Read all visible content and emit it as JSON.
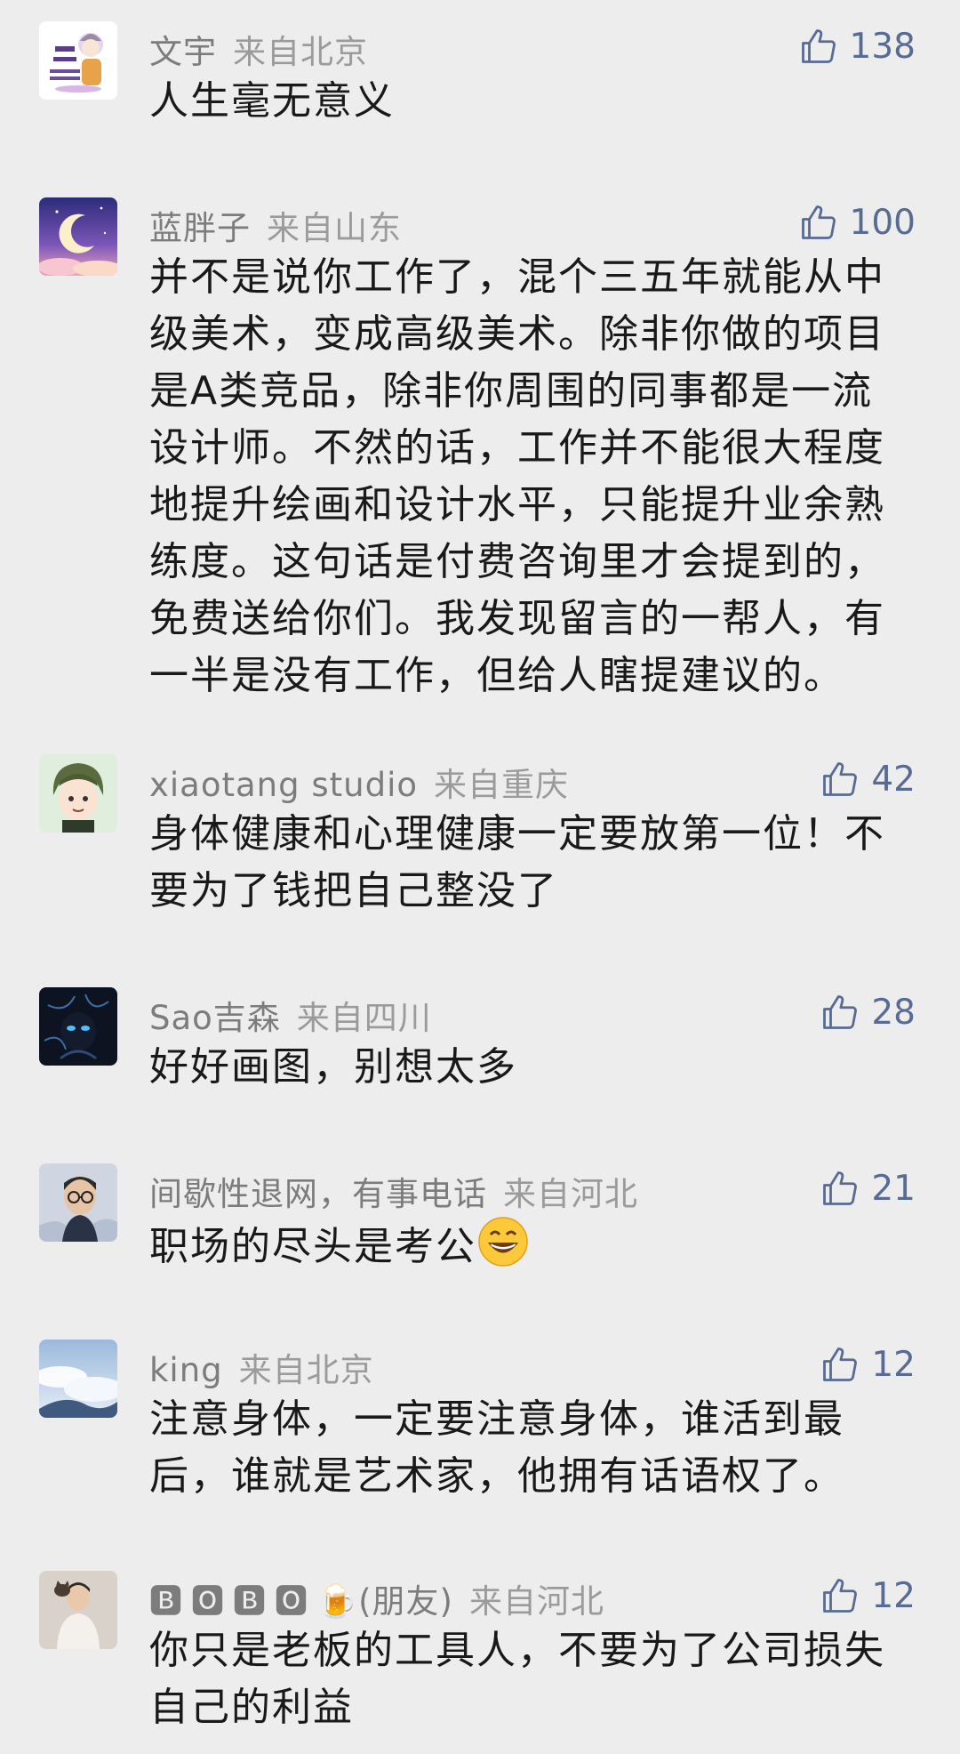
{
  "comments": [
    {
      "name": "文宇",
      "location": "来自北京",
      "likes": "138",
      "text": "人生毫无意义",
      "avatar": "cartoon-monk-avatar"
    },
    {
      "name": "蓝胖子",
      "location": "来自山东",
      "likes": "100",
      "text": "并不是说你工作了，混个三五年就能从中级美术，变成高级美术。除非你做的项目是A类竞品，除非你周围的同事都是一流设计师。不然的话，工作并不能很大程度地提升绘画和设计水平，只能提升业余熟练度。这句话是付费咨询里才会提到的，免费送给你们。我发现留言的一帮人，有一半是没有工作，但给人瞎提建议的。",
      "avatar": "moon-night-sky-avatar"
    },
    {
      "name": "xiaotang studio",
      "location": "来自重庆",
      "likes": "42",
      "text": "身体健康和心理健康一定要放第一位！不要为了钱把自己整没了",
      "avatar": "anime-boy-avatar"
    },
    {
      "name": "Sao吉森",
      "location": "来自四川",
      "likes": "28",
      "text": "好好画图，别想太多",
      "avatar": "dark-creature-avatar"
    },
    {
      "name": "间歇性退网，有事电话",
      "location": "来自河北",
      "likes": "21",
      "text": "职场的尽头是考公",
      "emoji": "grinning-emoji",
      "avatar": "man-with-glasses-avatar"
    },
    {
      "name": "king",
      "location": "来自北京",
      "likes": "12",
      "text": "注意身体，一定要注意身体，谁活到最后，谁就是艺术家，他拥有话语权了。",
      "avatar": "sky-clouds-avatar"
    },
    {
      "name": "🅱🅾🅱🅾",
      "name_suffix": "(朋友)",
      "location": "来自河北",
      "likes": "12",
      "text": "你只是老板的工具人，不要为了公司损失自己的利益",
      "name_emoji": "beer-mug-emoji",
      "avatar": "person-with-cat-avatar"
    }
  ],
  "colors": {
    "background": "#ededed",
    "name": "#7c7c7c",
    "location": "#9b9b9b",
    "like": "#576b95",
    "text": "#191919"
  }
}
